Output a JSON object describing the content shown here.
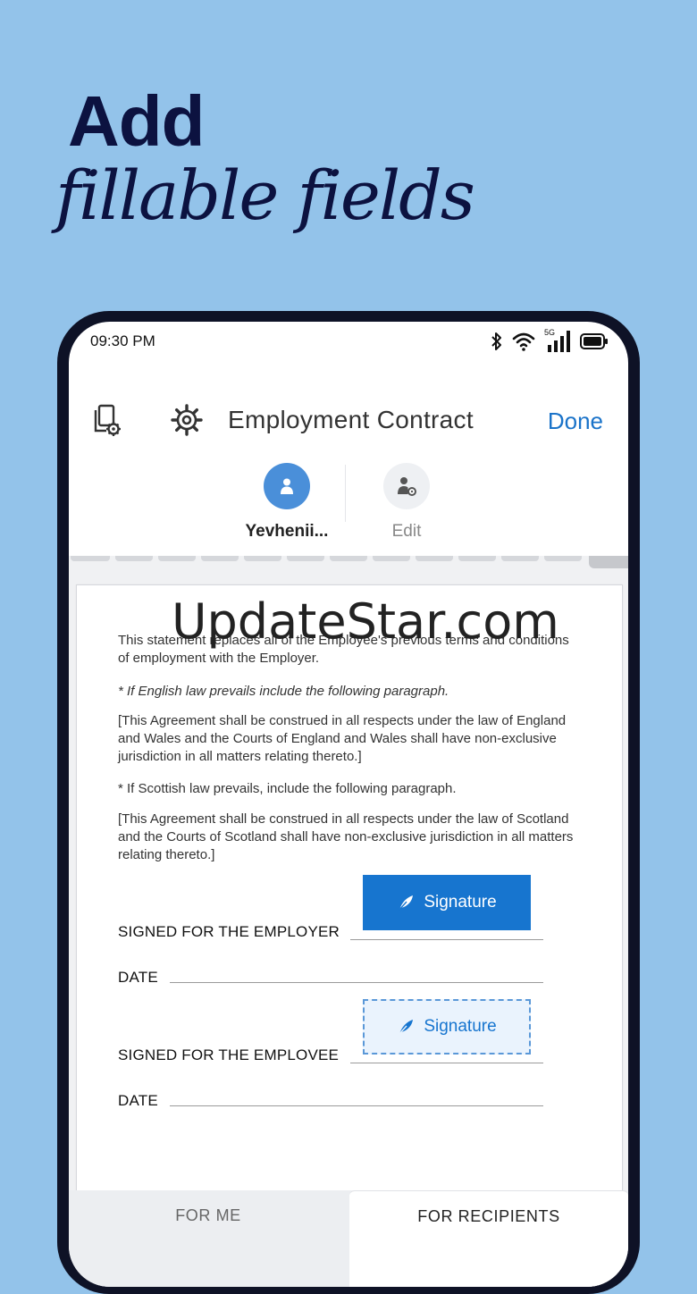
{
  "headline": {
    "line1": "Add",
    "line2": "fillable fields"
  },
  "status": {
    "time": "09:30 PM",
    "net_badge": "5G"
  },
  "topbar": {
    "title": "Employment Contract",
    "done_label": "Done"
  },
  "recipients": [
    {
      "name": "Yevhenii...",
      "active": true
    },
    {
      "name": "Edit",
      "active": false
    }
  ],
  "document": {
    "paragraphs": [
      "This statement replaces all of the Employee's previous terms and conditions of employment with the Employer.",
      "* If English law prevails include the following paragraph.",
      "[This Agreement shall be construed in all respects under the law of England and Wales and the Courts of England and Wales shall have non-exclusive jurisdiction in all matters relating thereto.]",
      "* If Scottish law prevails, include the following paragraph.",
      "[This Agreement shall be construed in all respects under the law of Scotland and the Courts of Scotland shall have non-exclusive jurisdiction in all matters relating thereto.]"
    ],
    "employer_label": "SIGNED FOR THE EMPLOYER",
    "employee_label": "SIGNED FOR THE EMPLOVEE",
    "date_label": "DATE",
    "signature_label": "Signature"
  },
  "watermark": "UpdateStar.com",
  "bottom_tabs": [
    {
      "label": "FOR ME",
      "active": false
    },
    {
      "label": "FOR RECIPIENTS",
      "active": true
    }
  ],
  "colors": {
    "background": "#93c3ea",
    "accent": "#1775cf",
    "headline": "#0c1240"
  }
}
